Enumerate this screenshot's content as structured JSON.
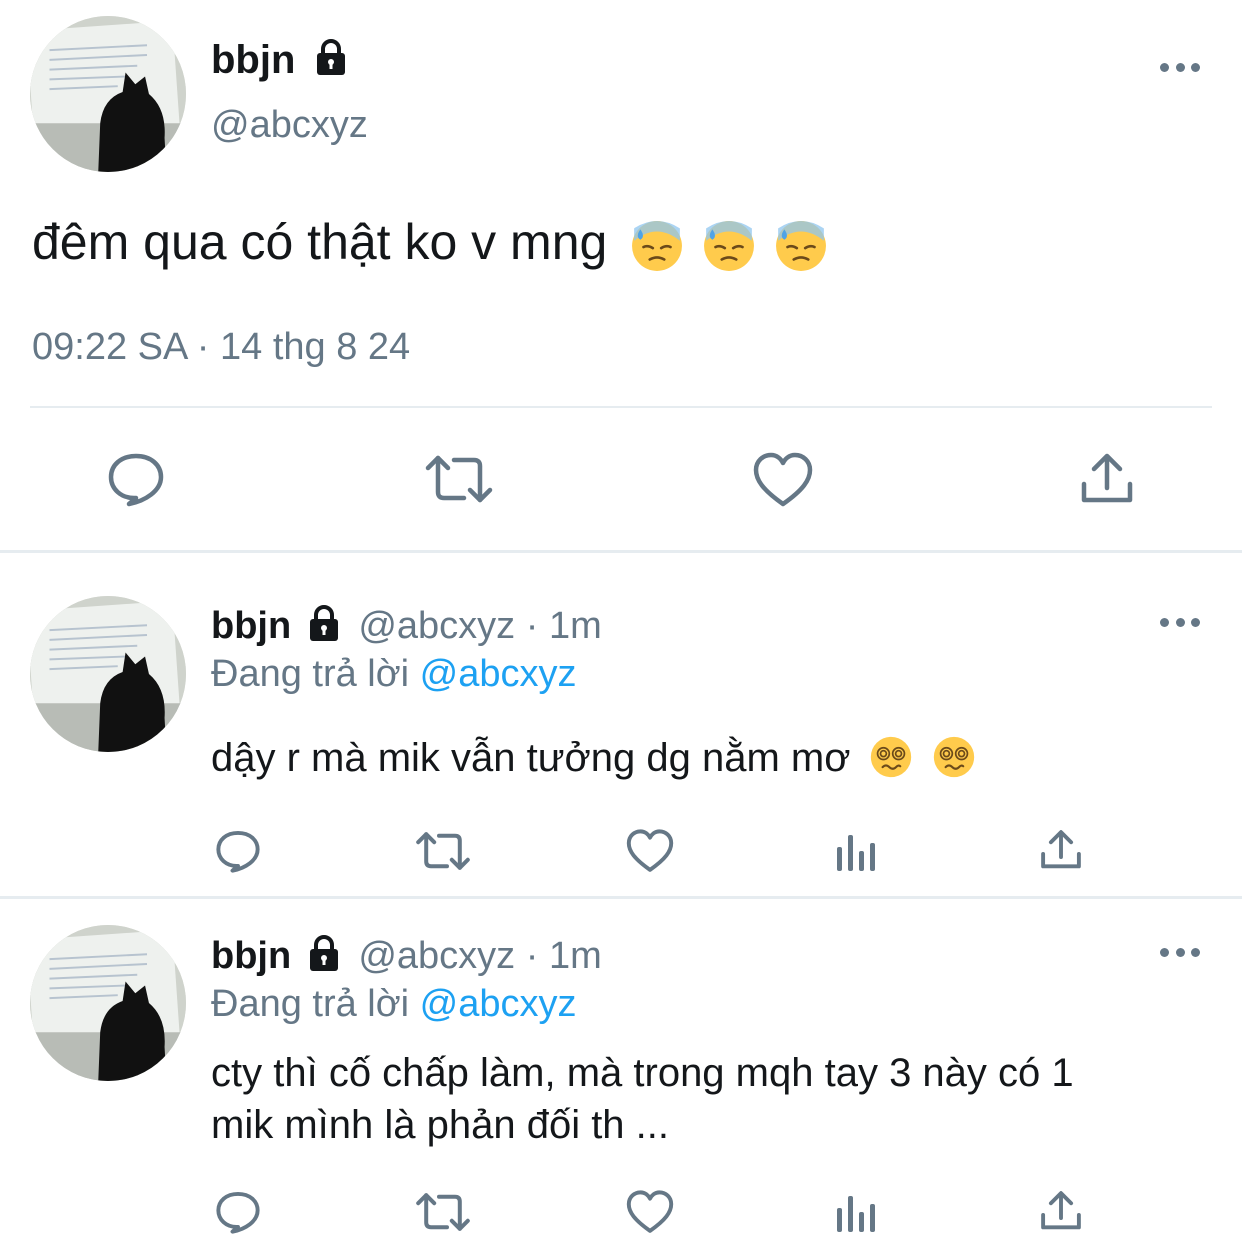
{
  "main_tweet": {
    "display_name": "bbjn",
    "handle": "@abcxyz",
    "text": "đêm qua có thật ko v mng",
    "emoji_count": 3,
    "timestamp": "09:22 SA · 14 thg 8 24"
  },
  "replies": [
    {
      "display_name": "bbjn",
      "handle": "@abcxyz",
      "dot": "·",
      "time": "1m",
      "replying_prefix": "Đang trả lời",
      "replying_to": "@abcxyz",
      "line1": "dậy r mà mik vẫn tưởng dg nằm mơ",
      "line2": "",
      "emoji_count": 2
    },
    {
      "display_name": "bbjn",
      "handle": "@abcxyz",
      "dot": "·",
      "time": "1m",
      "replying_prefix": "Đang trả lời",
      "replying_to": "@abcxyz",
      "line1": "cty thì cố chấp làm, mà trong mqh tay 3 này có 1",
      "line2": "mik mình là phản đối th ...",
      "emoji_count": 0
    }
  ],
  "icons": {
    "reply": "reply-icon",
    "retweet": "retweet-icon",
    "like": "like-icon",
    "analytics": "analytics-icon",
    "share": "share-icon",
    "lock": "lock-icon",
    "more": "more-icon"
  },
  "colors": {
    "text": "#14171a",
    "muted": "#657786",
    "link": "#1da1f2",
    "divider": "#e6ecf0"
  }
}
